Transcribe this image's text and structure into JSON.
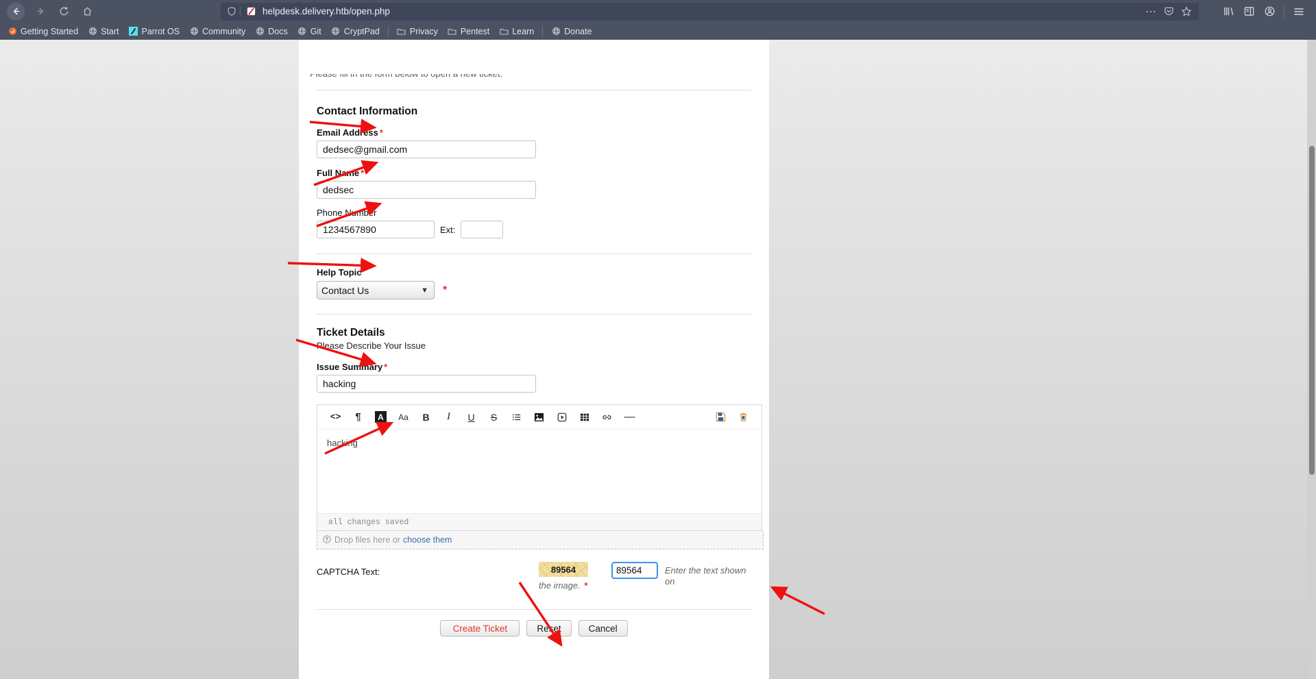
{
  "browser": {
    "nav": {
      "back_icon": "arrow-left-icon",
      "forward_icon": "arrow-right-icon",
      "reload_icon": "reload-icon",
      "home_icon": "home-icon"
    },
    "url": "helpdesk.delivery.htb/open.php",
    "urlbar_icons": {
      "shield": "shield-icon",
      "noscript": "noscript-icon",
      "more": "ellipsis-icon",
      "pocket": "pocket-icon",
      "bookmark": "star-icon"
    },
    "right_icons": {
      "library": "library-icon",
      "sidebar": "sidebar-icon",
      "account": "account-icon",
      "menu": "hamburger-menu-icon"
    },
    "bookmarks": [
      {
        "label": "Getting Started",
        "icon": "firefox-icon"
      },
      {
        "label": "Start",
        "icon": "globe-icon"
      },
      {
        "label": "Parrot OS",
        "icon": "parrot-icon"
      },
      {
        "label": "Community",
        "icon": "globe-icon"
      },
      {
        "label": "Docs",
        "icon": "globe-icon"
      },
      {
        "label": "Git",
        "icon": "globe-icon"
      },
      {
        "label": "CryptPad",
        "icon": "globe-icon"
      },
      {
        "label": "Privacy",
        "icon": "folder-icon",
        "separator_before": true
      },
      {
        "label": "Pentest",
        "icon": "folder-icon"
      },
      {
        "label": "Learn",
        "icon": "folder-icon"
      },
      {
        "label": "Donate",
        "icon": "globe-icon",
        "separator_before": true
      }
    ]
  },
  "page": {
    "intro_cut_text": "Please fill in the form below to open a new ticket.",
    "contact_section": {
      "title": "Contact Information",
      "email": {
        "label": "Email Address",
        "required": true,
        "value": "dedsec@gmail.com"
      },
      "full_name": {
        "label": "Full Name",
        "required": true,
        "value": "dedsec"
      },
      "phone": {
        "label": "Phone Number",
        "required": false,
        "value": "1234567890"
      },
      "ext": {
        "label": "Ext:",
        "value": ""
      }
    },
    "help_topic": {
      "label": "Help Topic",
      "selected": "Contact Us",
      "required": true,
      "options": [
        "Contact Us"
      ]
    },
    "ticket_details": {
      "title": "Ticket Details",
      "subtitle": "Please Describe Your Issue",
      "issue_summary": {
        "label": "Issue Summary",
        "required": true,
        "value": "hacking"
      },
      "editor": {
        "toolbar": [
          {
            "name": "source-code-icon",
            "glyph": "<>"
          },
          {
            "name": "paragraph-icon",
            "glyph": "¶"
          },
          {
            "name": "text-color-icon",
            "glyph": "A"
          },
          {
            "name": "font-size-icon",
            "glyph": "Aa"
          },
          {
            "name": "bold-icon",
            "glyph": "B"
          },
          {
            "name": "italic-icon",
            "glyph": "I"
          },
          {
            "name": "underline-icon",
            "glyph": "U"
          },
          {
            "name": "strikethrough-icon",
            "glyph": "S"
          },
          {
            "name": "bullet-list-icon",
            "glyph": "≣"
          },
          {
            "name": "image-icon",
            "glyph": "▣"
          },
          {
            "name": "video-icon",
            "glyph": "▶"
          },
          {
            "name": "table-icon",
            "glyph": "▦"
          },
          {
            "name": "link-icon",
            "glyph": "🔗"
          },
          {
            "name": "horizontal-rule-icon",
            "glyph": "—"
          }
        ],
        "toolbar_right": [
          {
            "name": "save-icon",
            "glyph": "💾"
          },
          {
            "name": "delete-icon",
            "glyph": "🗑"
          }
        ],
        "body_text": "hacking",
        "status": "all changes saved"
      },
      "dropzone": {
        "icon": "upload-circle-icon",
        "text": "Drop files here or",
        "link": "choose them"
      }
    },
    "captcha": {
      "label": "CAPTCHA Text:",
      "image_text": "89564",
      "input_value": "89564",
      "hint_left": "the image.",
      "hint_right": "Enter the text shown on",
      "required": true
    },
    "buttons": {
      "create": "Create Ticket",
      "reset": "Reset",
      "cancel": "Cancel"
    }
  },
  "colors": {
    "chrome_bg": "#4b5262",
    "accent_red": "#e23a2e",
    "required_red": "#d9382c",
    "link_blue": "#3a6ea5",
    "focus_blue": "#3b92f0",
    "captcha_bg": "#f2dd9e",
    "arrow_red": "#ee1111"
  }
}
